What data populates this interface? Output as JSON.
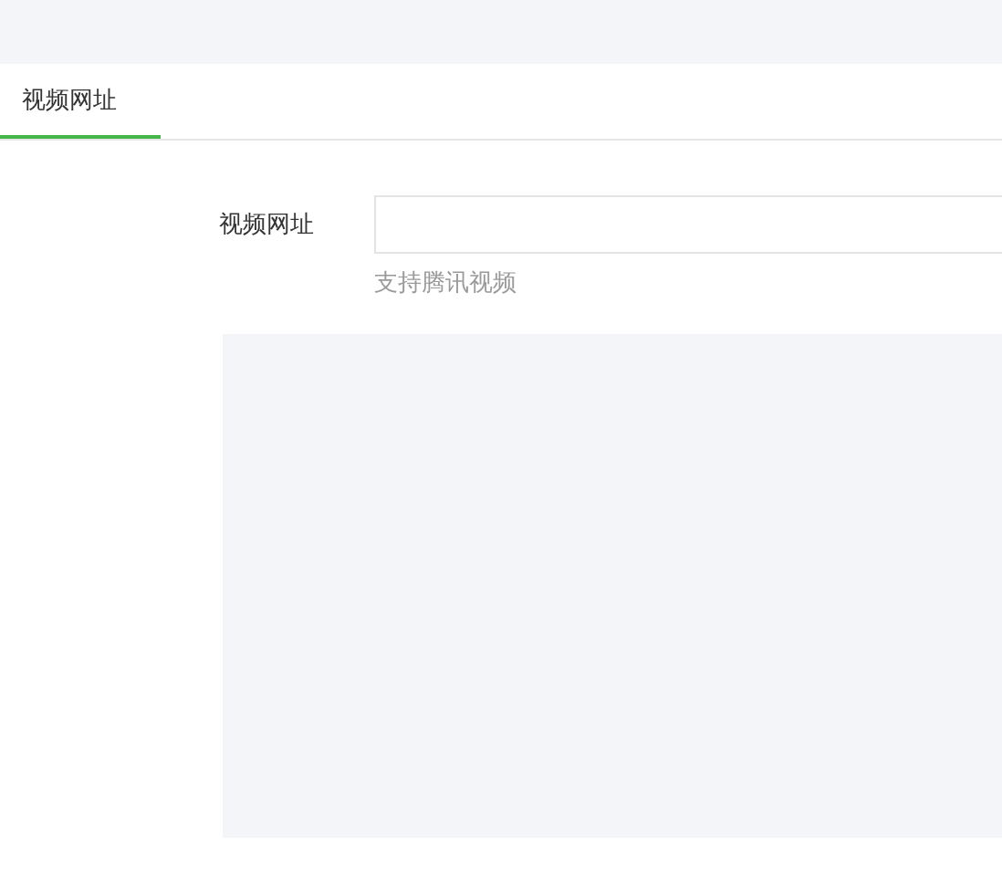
{
  "tabs": [
    {
      "label": "视频网址",
      "selected": true
    }
  ],
  "form": {
    "label": "视频网址",
    "hint": "支持腾讯视频"
  }
}
